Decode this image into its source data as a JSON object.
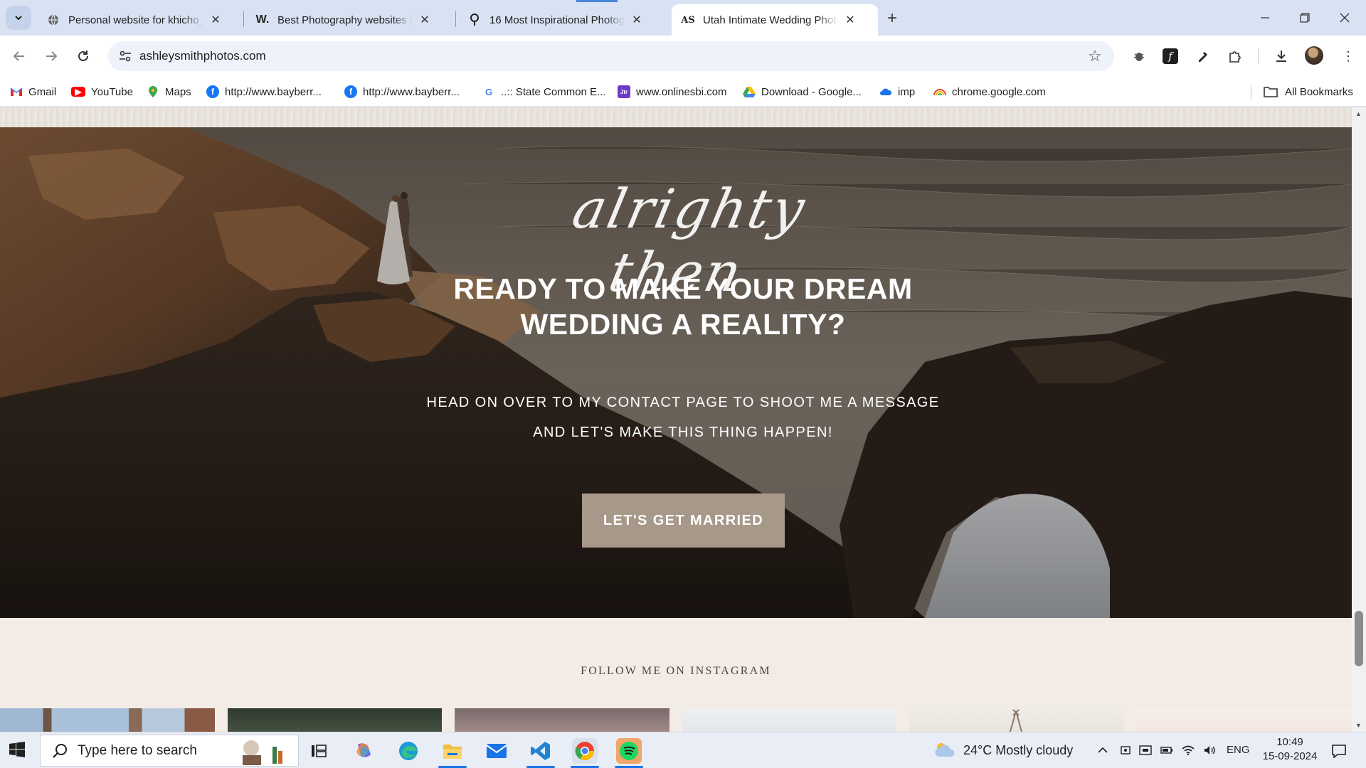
{
  "browser": {
    "tabs": [
      {
        "title": "Personal website for khicho_pic",
        "favicon": "globe-icon",
        "active": false
      },
      {
        "title": "Best Photography websites | W",
        "favicon": "w-logo-icon",
        "active": false
      },
      {
        "title": "16 Most Inspirational Photogra",
        "favicon": "pin-icon",
        "active": false
      },
      {
        "title": "Utah Intimate Wedding Photog",
        "favicon": "as-monogram-icon",
        "active": true
      }
    ],
    "url": "ashleysmithphotos.com",
    "bookmarks": [
      {
        "label": "Gmail",
        "icon": "gmail-icon"
      },
      {
        "label": "YouTube",
        "icon": "youtube-icon"
      },
      {
        "label": "Maps",
        "icon": "maps-icon"
      },
      {
        "label": "http://www.bayberr...",
        "icon": "facebook-icon"
      },
      {
        "label": "http://www.bayberr...",
        "icon": "facebook-icon"
      },
      {
        "label": "..:: State Common E...",
        "icon": "google-icon"
      },
      {
        "label": "www.onlinesbi.com",
        "icon": "sbi-icon"
      },
      {
        "label": "Download - Google...",
        "icon": "drive-icon"
      },
      {
        "label": "imp",
        "icon": "cloud-icon"
      },
      {
        "label": "chrome.google.com",
        "icon": "rainbow-icon"
      }
    ],
    "all_bookmarks": "All Bookmarks"
  },
  "page": {
    "script_heading": "alrighty then",
    "title_line1": "READY TO MAKE YOUR DREAM",
    "title_line2": "WEDDING A REALITY?",
    "sub_line1": "HEAD ON OVER TO MY CONTACT PAGE TO SHOOT ME A MESSAGE",
    "sub_line2": "AND LET'S MAKE THIS THING HAPPEN!",
    "cta_label": "LET'S GET MARRIED",
    "instagram_heading": "FOLLOW ME ON INSTAGRAM",
    "accent_color": "#a8988a"
  },
  "taskbar": {
    "search_placeholder": "Type here to search",
    "weather": "24°C  Mostly cloudy",
    "language": "ENG",
    "time": "10:49",
    "date": "15-09-2024"
  }
}
